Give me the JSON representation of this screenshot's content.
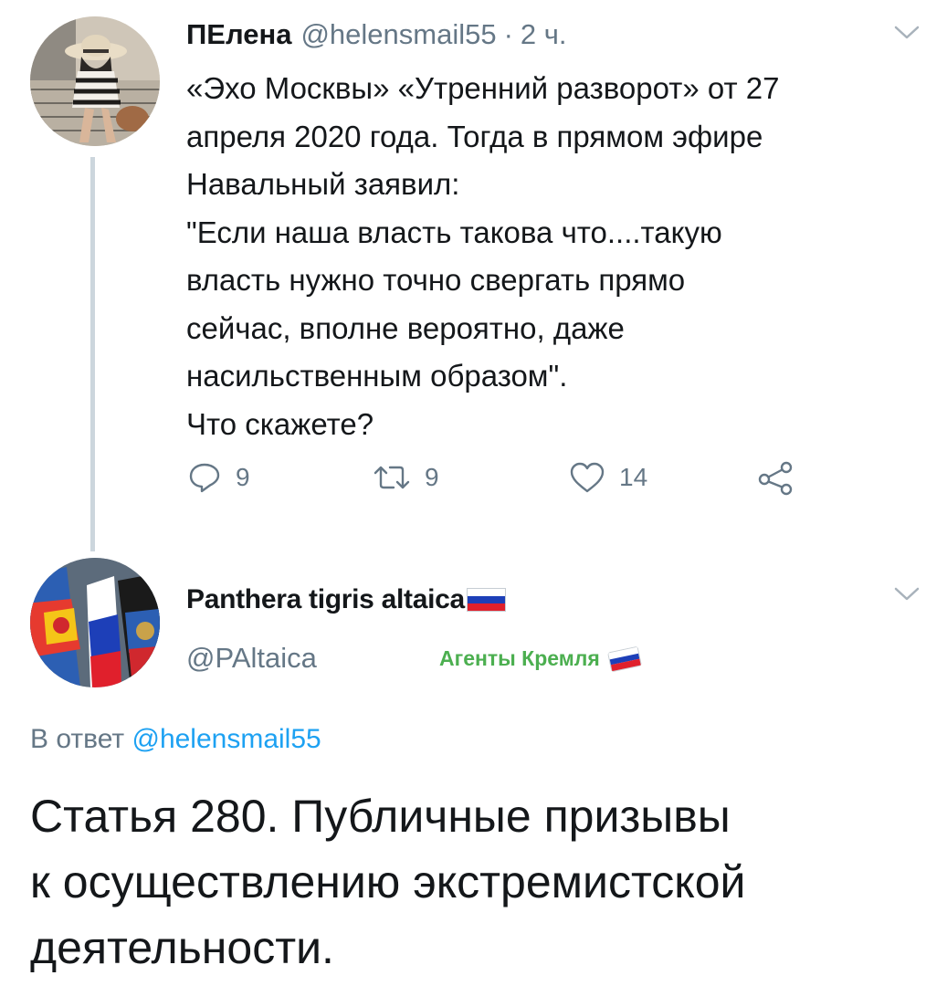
{
  "tweet1": {
    "author_name": "ПЕлена",
    "author_handle": "@helensmail55",
    "separator": "·",
    "time": "2 ч.",
    "body_lines": [
      "«Эхо Москвы» «Утренний разворот» от 27",
      "апреля 2020 года. Тогда в прямом эфире",
      "Навальный заявил:",
      "\"Если наша власть такова что....такую",
      "власть нужно точно свергать прямо",
      "сейчас, вполне вероятно, даже",
      "насильственным образом\".",
      "Что скажете?"
    ],
    "actions": {
      "replies": "9",
      "retweets": "9",
      "likes": "14"
    },
    "icons": [
      "reply-icon",
      "retweet-icon",
      "like-icon",
      "share-icon",
      "chevron-down-icon"
    ]
  },
  "tweet2": {
    "author_name": "Panthera tigris altaica",
    "author_handle": "@PAltaica",
    "tag": "Агенты Кремля",
    "reply_prefix": "В ответ",
    "reply_mention": "@helensmail55",
    "body_lines": [
      "Статья 280. Публичные призывы",
      "к осуществлению экстремистской",
      "деятельности."
    ]
  },
  "colors": {
    "text": "#14171a",
    "secondary": "#657786",
    "link": "#1da1f2",
    "tag_green": "#4caf50",
    "thread_line": "#ccd6dd",
    "flag_white": "#ffffff",
    "flag_blue": "#1d3fb8",
    "flag_red": "#e0202c"
  }
}
